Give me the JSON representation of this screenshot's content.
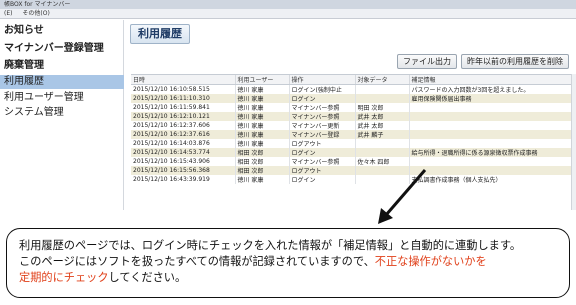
{
  "window": {
    "title": "帳BOX for マイナンバー"
  },
  "menubar": {
    "items": [
      "(E)",
      "その他(O)"
    ]
  },
  "sidebar": {
    "items": [
      {
        "label": "お知らせ",
        "bold": true
      },
      {
        "label": "マイナンバー登録管理",
        "bold": true
      },
      {
        "label": "廃棄管理",
        "bold": true
      },
      {
        "label": "利用履歴",
        "bold": false,
        "active": true
      },
      {
        "label": "利用ユーザー管理",
        "bold": false
      },
      {
        "label": "システム管理",
        "bold": false
      }
    ]
  },
  "main": {
    "page_title": "利用履歴",
    "buttons": {
      "export": "ファイル出力",
      "delete_old": "昨年以前の利用履歴を削除"
    },
    "table": {
      "columns": [
        "日時",
        "利用ユーザー",
        "操作",
        "対象データ",
        "補足情報"
      ],
      "rows": [
        [
          "2015/12/10 16:10:58.515",
          "徳川 家康",
          "ログイン(強制中止",
          "",
          "パスワードの入力回数が3回を超えました。"
        ],
        [
          "2015/12/10 16:11:10.310",
          "徳川 家康",
          "ログイン",
          "",
          "雇用保険関係届出事務"
        ],
        [
          "2015/12/10 16:11:59.841",
          "徳川 家康",
          "マイナンバー参照",
          "明田 次郎",
          ""
        ],
        [
          "2015/12/10 16:12:10.121",
          "徳川 家康",
          "マイナンバー参照",
          "武井 太郎",
          ""
        ],
        [
          "2015/12/10 16:12:37.606",
          "徳川 家康",
          "マイナンバー更新",
          "武井 太郎",
          ""
        ],
        [
          "2015/12/10 16:12:37.616",
          "徳川 家康",
          "マイナンバー登録",
          "武井 麟子",
          ""
        ],
        [
          "2015/12/10 16:14:03.876",
          "徳川 家康",
          "ログアウト",
          "",
          ""
        ],
        [
          "2015/12/10 16:14:53.774",
          "相田 次郎",
          "ログイン",
          "",
          "給与所得・退職所得に係る源泉徴収票作成事務"
        ],
        [
          "2015/12/10 16:15:43.906",
          "相田 次郎",
          "マイナンバー参照",
          "佐々木 四郎",
          ""
        ],
        [
          "2015/12/10 16:15:56.368",
          "相田 次郎",
          "ログアウト",
          "",
          ""
        ],
        [
          "2015/12/10 16:43:39.919",
          "徳川 家康",
          "ログイン",
          "",
          "支払調書作成事務（個人支払先）"
        ]
      ]
    }
  },
  "callout": {
    "line1": "利用履歴のページでは、ログイン時にチェックを入れた情報が「補足情報」と自動的に連動します。",
    "line2_black": "このページにはソフトを扱ったすべての情報が記録されていますので、",
    "line2_red": "不正な操作がないかを",
    "line3_red": "定期的にチェック",
    "line3_black": "してください。"
  }
}
